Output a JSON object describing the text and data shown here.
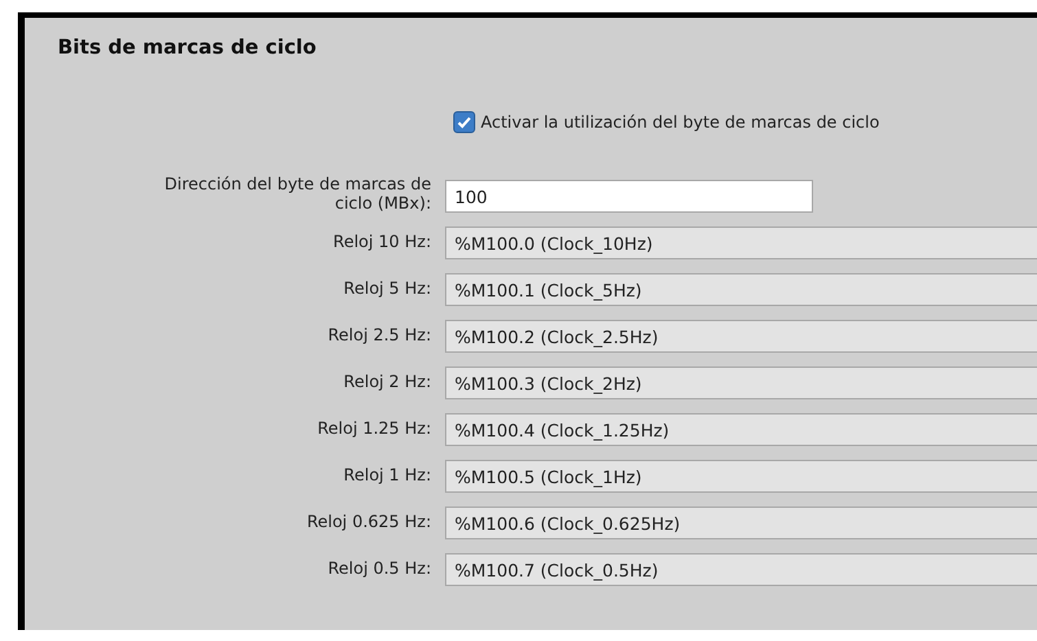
{
  "panel": {
    "title": "Bits de marcas de ciclo"
  },
  "enable_checkbox": {
    "label": "Activar la utilización del byte de marcas de ciclo",
    "checked": true
  },
  "fields": [
    {
      "label": "Dirección del byte de marcas de ciclo (MBx):",
      "value": "100",
      "readonly": false
    },
    {
      "label": "Reloj 10 Hz:",
      "value": "%M100.0 (Clock_10Hz)",
      "readonly": true
    },
    {
      "label": "Reloj 5 Hz:",
      "value": "%M100.1 (Clock_5Hz)",
      "readonly": true
    },
    {
      "label": "Reloj 2.5 Hz:",
      "value": "%M100.2 (Clock_2.5Hz)",
      "readonly": true
    },
    {
      "label": "Reloj 2 Hz:",
      "value": "%M100.3 (Clock_2Hz)",
      "readonly": true
    },
    {
      "label": "Reloj 1.25 Hz:",
      "value": "%M100.4 (Clock_1.25Hz)",
      "readonly": true
    },
    {
      "label": "Reloj 1 Hz:",
      "value": "%M100.5 (Clock_1Hz)",
      "readonly": true
    },
    {
      "label": "Reloj 0.625 Hz:",
      "value": "%M100.6 (Clock_0.625Hz)",
      "readonly": true
    },
    {
      "label": "Reloj 0.5 Hz:",
      "value": "%M100.7 (Clock_0.5Hz)",
      "readonly": true
    }
  ]
}
